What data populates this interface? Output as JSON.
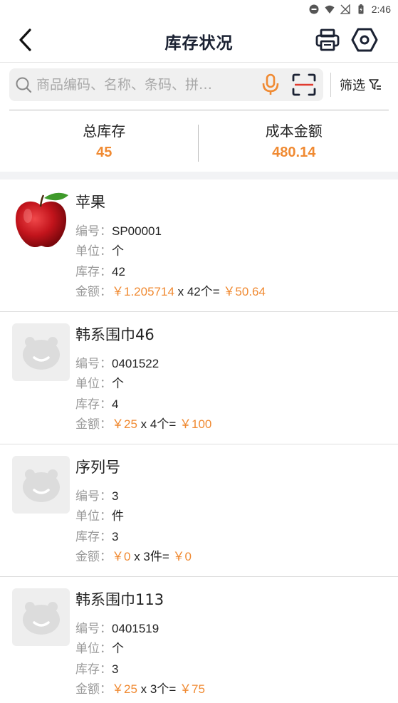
{
  "status_bar": {
    "time": "2:46"
  },
  "header": {
    "title": "库存状况"
  },
  "search": {
    "placeholder": "商品编码、名称、条码、拼…",
    "filter_label": "筛选"
  },
  "summary": {
    "total_stock_label": "总库存",
    "total_stock_value": "45",
    "cost_label": "成本金额",
    "cost_value": "480.14"
  },
  "labels": {
    "code": "编号：",
    "unit": "单位：",
    "stock": "库存：",
    "amount": "金额："
  },
  "products": [
    {
      "name": "苹果",
      "code": "SP00001",
      "unit": "个",
      "stock": "42",
      "price": "￥1.205714",
      "mult": " x 42个= ",
      "total": "￥50.64",
      "image": "apple"
    },
    {
      "name": "韩系围巾46",
      "code": "0401522",
      "unit": "个",
      "stock": "4",
      "price": "￥25",
      "mult": " x 4个= ",
      "total": "￥100",
      "image": "placeholder"
    },
    {
      "name": "序列号",
      "code": "3",
      "unit": "件",
      "stock": "3",
      "price": "￥0",
      "mult": " x 3件= ",
      "total": "￥0",
      "image": "placeholder"
    },
    {
      "name": "韩系围巾113",
      "code": "0401519",
      "unit": "个",
      "stock": "3",
      "price": "￥25",
      "mult": " x 3个= ",
      "total": "￥75",
      "image": "placeholder"
    }
  ],
  "colors": {
    "accent": "#f08a32",
    "title": "#1b2233",
    "scan_line": "#e03a2e"
  }
}
